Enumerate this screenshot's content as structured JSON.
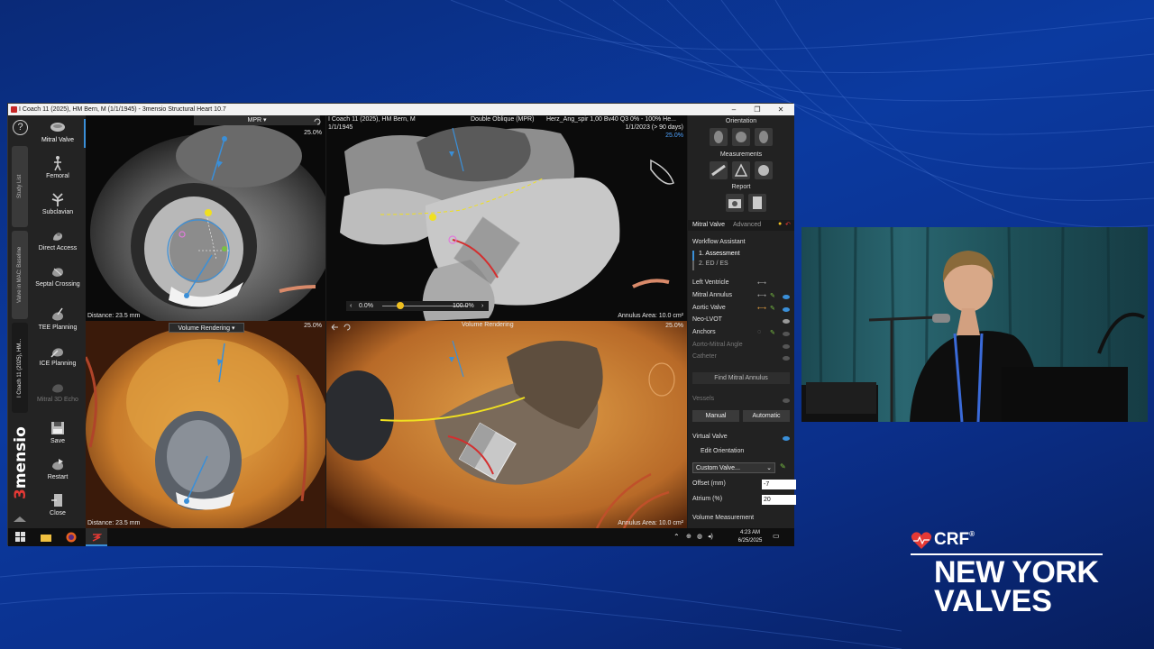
{
  "window": {
    "title": "I Coach 11 (2025), HM Bern, M (1/1/1945) - 3mensio Structural Heart 10.7",
    "minimize": "–",
    "maximize": "❐",
    "close": "✕"
  },
  "left_bar": {
    "help": "?",
    "vtabs": [
      "Study List",
      "Valve in MAC: Baseline",
      "I Coach 11 (2025), HM..."
    ],
    "brand_three": "3",
    "brand_rest": "mensio",
    "tools": [
      {
        "label": "Mitral Valve",
        "icon": "mitral-valve-icon"
      },
      {
        "label": "Femoral",
        "icon": "femoral-icon"
      },
      {
        "label": "Subclavian",
        "icon": "subclavian-icon"
      },
      {
        "label": "Direct Access",
        "icon": "direct-access-icon"
      },
      {
        "label": "Septal Crossing",
        "icon": "septal-crossing-icon"
      },
      {
        "label": "TEE Planning",
        "icon": "tee-planning-icon"
      },
      {
        "label": "ICE Planning",
        "icon": "ice-planning-icon"
      },
      {
        "label": "Mitral 3D Echo",
        "icon": "mitral-3d-echo-icon"
      },
      {
        "label": "Save",
        "icon": "save-icon"
      },
      {
        "label": "Restart",
        "icon": "restart-icon"
      },
      {
        "label": "Close",
        "icon": "close-icon"
      }
    ]
  },
  "viewports": {
    "top_left": {
      "header": "MPR",
      "zoom": "25.0%",
      "distance": "Distance: 23.5 mm"
    },
    "top_right": {
      "patient": "I Coach 11 (2025), HM Bern, M",
      "dob": "1/1/1945",
      "mode": "Double Oblique (MPR)",
      "series": "Herz_Ang_spir 1,00 Bv40 Q3 0% - 100% He...",
      "date": "1/1/2023 (> 90 days)",
      "zoom": "25.0%",
      "slider_left": "0.0%",
      "slider_right": "100.0%",
      "annulus": "Annulus Area: 10.0 cm²"
    },
    "bottom_left": {
      "header": "Volume Rendering",
      "zoom": "25.0%",
      "distance": "Distance: 23.5 mm"
    },
    "bottom_right": {
      "header": "Volume Rendering",
      "zoom": "25.0%",
      "annulus": "Annulus Area: 10.0 cm²"
    }
  },
  "right_panel": {
    "orientation": "Orientation",
    "measurements": "Measurements",
    "report": "Report",
    "tab_mitral": "Mitral Valve",
    "tab_advanced": "Advanced",
    "workflow_title": "Workflow Assistant",
    "workflow_steps": [
      "1. Assessment",
      "2. ED / ES"
    ],
    "structures": [
      {
        "label": "Left Ventricle"
      },
      {
        "label": "Mitral Annulus"
      },
      {
        "label": "Aortic Valve"
      },
      {
        "label": "Neo-LVOT"
      },
      {
        "label": "Anchors"
      },
      {
        "label": "Aorto-Mitral Angle"
      },
      {
        "label": "Catheter"
      }
    ],
    "find_button": "Find Mitral Annulus",
    "vessels": "Vessels",
    "manual": "Manual",
    "automatic": "Automatic",
    "virtual_valve": "Virtual Valve",
    "edit_orientation": "Edit Orientation",
    "custom_valve": "Custom Valve...",
    "offset_label": "Offset (mm)",
    "offset_value": "-7",
    "atrium_label": "Atrium (%)",
    "atrium_value": "20",
    "volume_measurement": "Volume Measurement"
  },
  "taskbar": {
    "time": "4:23 AM",
    "date": "6/25/2025"
  },
  "logo": {
    "crf": "CRF",
    "reg": "®",
    "line1": "NEW YORK",
    "line2": "VALVES"
  },
  "colors": {
    "accent_blue": "#3a8fd8",
    "brand_red": "#e53935",
    "ct_yellow": "#f0e020",
    "vr_orange": "#d98a2a"
  }
}
